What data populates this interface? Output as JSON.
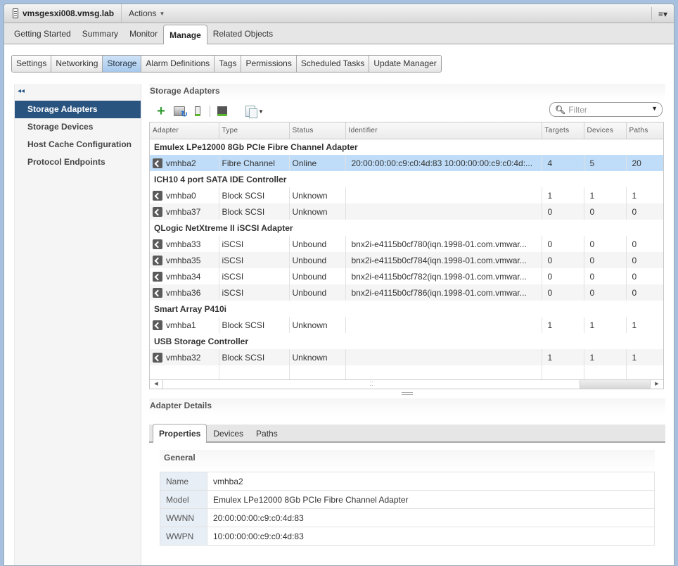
{
  "header": {
    "host_name": "vmsgesxi008.vmsg.lab",
    "actions_label": "Actions",
    "menu_icon": "list-menu-icon"
  },
  "main_tabs": [
    {
      "label": "Getting Started",
      "active": false
    },
    {
      "label": "Summary",
      "active": false
    },
    {
      "label": "Monitor",
      "active": false
    },
    {
      "label": "Manage",
      "active": true
    },
    {
      "label": "Related Objects",
      "active": false
    }
  ],
  "sub_tabs": [
    {
      "label": "Settings",
      "active": false
    },
    {
      "label": "Networking",
      "active": false
    },
    {
      "label": "Storage",
      "active": true
    },
    {
      "label": "Alarm Definitions",
      "active": false
    },
    {
      "label": "Tags",
      "active": false
    },
    {
      "label": "Permissions",
      "active": false
    },
    {
      "label": "Scheduled Tasks",
      "active": false
    },
    {
      "label": "Update Manager",
      "active": false
    }
  ],
  "leftnav": {
    "collapse_glyph": "◂◂",
    "items": [
      {
        "label": "Storage Adapters",
        "active": true
      },
      {
        "label": "Storage Devices",
        "active": false
      },
      {
        "label": "Host Cache Configuration",
        "active": false
      },
      {
        "label": "Protocol Endpoints",
        "active": false
      }
    ]
  },
  "adapters": {
    "title": "Storage Adapters",
    "toolbar_icons": [
      "add-icon",
      "rescan-icon",
      "rescan-device-icon",
      "adapter-icon",
      "copy-icon"
    ],
    "filter_placeholder": "Filter",
    "columns": [
      "Adapter",
      "Type",
      "Status",
      "Identifier",
      "Targets",
      "Devices",
      "Paths"
    ],
    "groups": [
      {
        "name": "Emulex LPe12000 8Gb PCIe Fibre Channel Adapter",
        "rows": [
          {
            "adapter": "vmhba2",
            "type": "Fibre Channel",
            "status": "Online",
            "identifier": "20:00:00:00:c9:c0:4d:83 10:00:00:00:c9:c0:4d:...",
            "targets": "4",
            "devices": "5",
            "paths": "20",
            "selected": true
          }
        ]
      },
      {
        "name": "ICH10 4 port SATA IDE Controller",
        "rows": [
          {
            "adapter": "vmhba0",
            "type": "Block SCSI",
            "status": "Unknown",
            "identifier": "",
            "targets": "1",
            "devices": "1",
            "paths": "1"
          },
          {
            "adapter": "vmhba37",
            "type": "Block SCSI",
            "status": "Unknown",
            "identifier": "",
            "targets": "0",
            "devices": "0",
            "paths": "0"
          }
        ]
      },
      {
        "name": "QLogic NetXtreme II iSCSI Adapter",
        "rows": [
          {
            "adapter": "vmhba33",
            "type": "iSCSI",
            "status": "Unbound",
            "identifier": "bnx2i-e4115b0cf780(iqn.1998-01.com.vmwar...",
            "targets": "0",
            "devices": "0",
            "paths": "0"
          },
          {
            "adapter": "vmhba35",
            "type": "iSCSI",
            "status": "Unbound",
            "identifier": "bnx2i-e4115b0cf784(iqn.1998-01.com.vmwar...",
            "targets": "0",
            "devices": "0",
            "paths": "0"
          },
          {
            "adapter": "vmhba34",
            "type": "iSCSI",
            "status": "Unbound",
            "identifier": "bnx2i-e4115b0cf782(iqn.1998-01.com.vmwar...",
            "targets": "0",
            "devices": "0",
            "paths": "0"
          },
          {
            "adapter": "vmhba36",
            "type": "iSCSI",
            "status": "Unbound",
            "identifier": "bnx2i-e4115b0cf786(iqn.1998-01.com.vmwar...",
            "targets": "0",
            "devices": "0",
            "paths": "0"
          }
        ]
      },
      {
        "name": "Smart Array P410i",
        "rows": [
          {
            "adapter": "vmhba1",
            "type": "Block SCSI",
            "status": "Unknown",
            "identifier": "",
            "targets": "1",
            "devices": "1",
            "paths": "1"
          }
        ]
      },
      {
        "name": "USB Storage Controller",
        "rows": [
          {
            "adapter": "vmhba32",
            "type": "Block SCSI",
            "status": "Unknown",
            "identifier": "",
            "targets": "1",
            "devices": "1",
            "paths": "1"
          }
        ]
      }
    ]
  },
  "details": {
    "title": "Adapter Details",
    "tabs": [
      {
        "label": "Properties",
        "active": true
      },
      {
        "label": "Devices",
        "active": false
      },
      {
        "label": "Paths",
        "active": false
      }
    ],
    "general_title": "General",
    "properties": [
      {
        "key": "Name",
        "value": "vmhba2"
      },
      {
        "key": "Model",
        "value": "Emulex LPe12000 8Gb PCIe Fibre Channel Adapter"
      },
      {
        "key": "WWNN",
        "value": "20:00:00:00:c9:c0:4d:83"
      },
      {
        "key": "WWPN",
        "value": "10:00:00:00:c9:c0:4d:83"
      }
    ]
  },
  "colors": {
    "accent_selected_nav": "#2a5480",
    "selected_row": "#bfdcf8",
    "active_subtab": "#a7c9ec",
    "frame_background": "#a6c0de"
  }
}
